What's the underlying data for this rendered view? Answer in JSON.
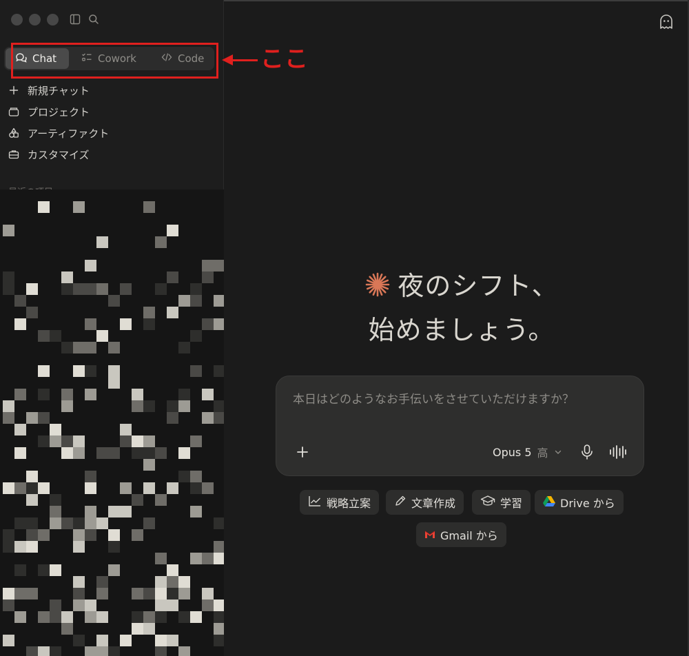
{
  "sidebar": {
    "modes": [
      {
        "label": "Chat",
        "icon": "chat-bubbles-icon",
        "active": true
      },
      {
        "label": "Cowork",
        "icon": "checklist-icon",
        "active": false
      },
      {
        "label": "Code",
        "icon": "code-brackets-icon",
        "active": false
      }
    ],
    "nav": [
      {
        "label": "新規チャット",
        "icon": "plus-icon"
      },
      {
        "label": "プロジェクト",
        "icon": "folder-icon"
      },
      {
        "label": "アーティファクト",
        "icon": "shapes-icon"
      },
      {
        "label": "カスタマイズ",
        "icon": "briefcase-icon"
      }
    ],
    "recents_label": "最近の項目"
  },
  "annotation": {
    "text": "ここ",
    "color": "#e0201e"
  },
  "main": {
    "greeting_line1": "夜のシフト、",
    "greeting_line2": "始めましょう。",
    "composer": {
      "placeholder": "本日はどのようなお手伝いをさせていただけますか？",
      "model": "Opus 5",
      "effort": "高"
    },
    "chips": [
      {
        "label": "戦略立案",
        "icon": "chart-line-icon"
      },
      {
        "label": "文章作成",
        "icon": "pencil-icon"
      },
      {
        "label": "学習",
        "icon": "graduation-cap-icon"
      },
      {
        "label": "Drive から",
        "icon": "google-drive-icon"
      },
      {
        "label": "Gmail から",
        "icon": "gmail-icon"
      }
    ]
  },
  "colors": {
    "accent_spark": "#d97757",
    "background": "#1b1b1b",
    "composer": "#2e2e2d"
  }
}
